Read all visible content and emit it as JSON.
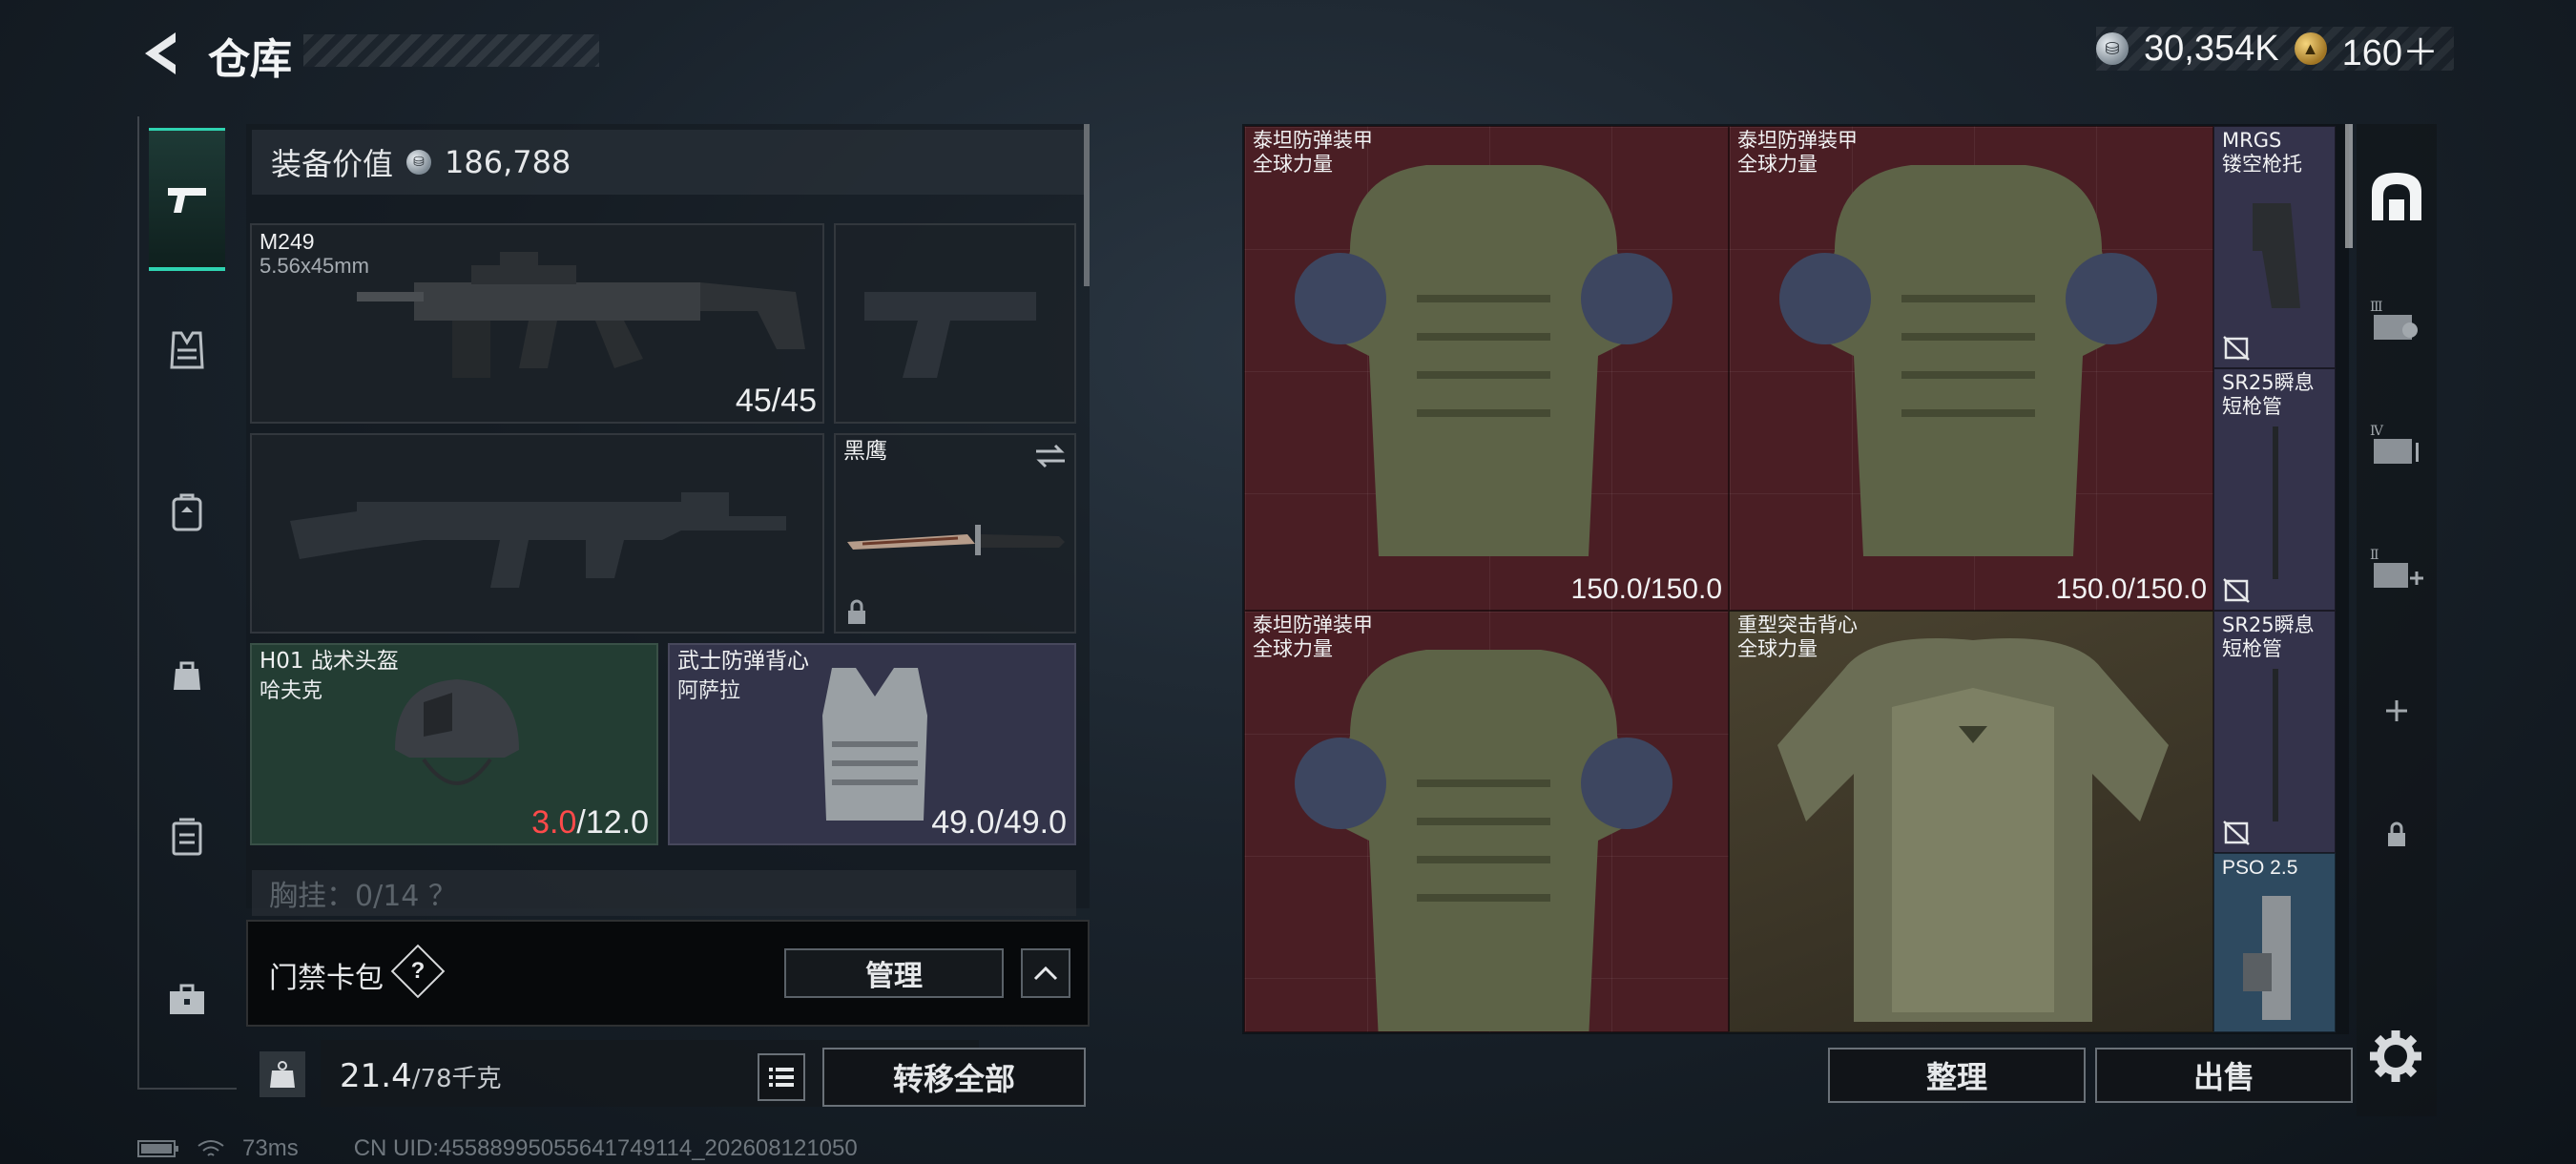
{
  "header": {
    "title": "仓库"
  },
  "currency": [
    {
      "icon": "silver-coin-icon",
      "value": "30,354K"
    },
    {
      "icon": "gold-coin-icon",
      "value": "160＋"
    }
  ],
  "equipment_value": {
    "label": "装备价值",
    "value": "186,788"
  },
  "slots": {
    "primary": {
      "name": "M249",
      "sub": "5.56x45mm",
      "ammo": "45/45"
    },
    "melee": {
      "name": "黑鹰"
    },
    "helmet": {
      "name": "H01 战术头盔",
      "sub": "哈夫克",
      "dur_cur": "3.0",
      "dur_max": "/12.0"
    },
    "armor": {
      "name": "武士防弹背心",
      "sub": "阿萨拉",
      "dur": "49.0/49.0"
    }
  },
  "chest_rig": {
    "text": "胸挂：0/14 ？"
  },
  "keybag": {
    "label": "门禁卡包",
    "help": "?",
    "manage": "管理"
  },
  "weight": {
    "current": "21.4",
    "max": "/78千克",
    "unit_icon": "KG"
  },
  "actions": {
    "transfer_all": "转移全部",
    "sort": "整理",
    "sell": "出售"
  },
  "status": {
    "ping": "73ms",
    "uid": "CN UID:4558899505564174911​4_202608121050"
  },
  "stash": [
    {
      "name": "泰坦防弹装甲",
      "sub": "全球力量",
      "dur": "150.0/150.0",
      "bg": "#4a1e24"
    },
    {
      "name": "泰坦防弹装甲",
      "sub": "全球力量",
      "dur": "150.0/150.0",
      "bg": "#4a1e24"
    },
    {
      "name": "MRGS",
      "sub": "镂空枪托",
      "bg": "#34334b"
    },
    {
      "name": "SR25瞬息",
      "sub": "短枪管",
      "bg": "#34334b"
    },
    {
      "name": "泰坦防弹装甲",
      "sub": "全球力量",
      "bg": "#4a1e24"
    },
    {
      "name": "重型突击背心",
      "sub": "全球力量",
      "bg": "#3a3426"
    },
    {
      "name": "SR25瞬息",
      "sub": "短枪管",
      "bg": "#34334b"
    },
    {
      "name": "PSO 2.5",
      "bg": "#34334b"
    }
  ],
  "right_sidebar": {
    "tab_I": "Ⅲ",
    "tab_IV": "Ⅳ",
    "tab_II": "Ⅱ"
  }
}
